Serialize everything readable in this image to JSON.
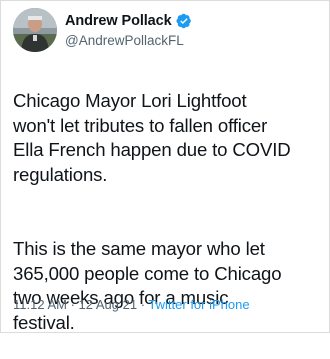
{
  "author": {
    "display_name": "Andrew Pollack",
    "handle": "@AndrewPollackFL",
    "verified": true,
    "verified_color": "#1d9bf0",
    "avatar_icon": "avatar-photo"
  },
  "tweet": {
    "paragraph_1": "Chicago Mayor Lori Lightfoot\nwon't let tributes to fallen officer\nElla French happen due to COVID\nregulations.",
    "paragraph_2": "This is the same mayor who let\n365,000 people come to Chicago\ntwo weeks ago for a music\nfestival."
  },
  "meta": {
    "time": "11:12 AM",
    "separator": " · ",
    "date": "12 Aug 21",
    "separator_2": " · ",
    "source": "Twitter for iPhone",
    "source_color": "#1d9bf0"
  }
}
